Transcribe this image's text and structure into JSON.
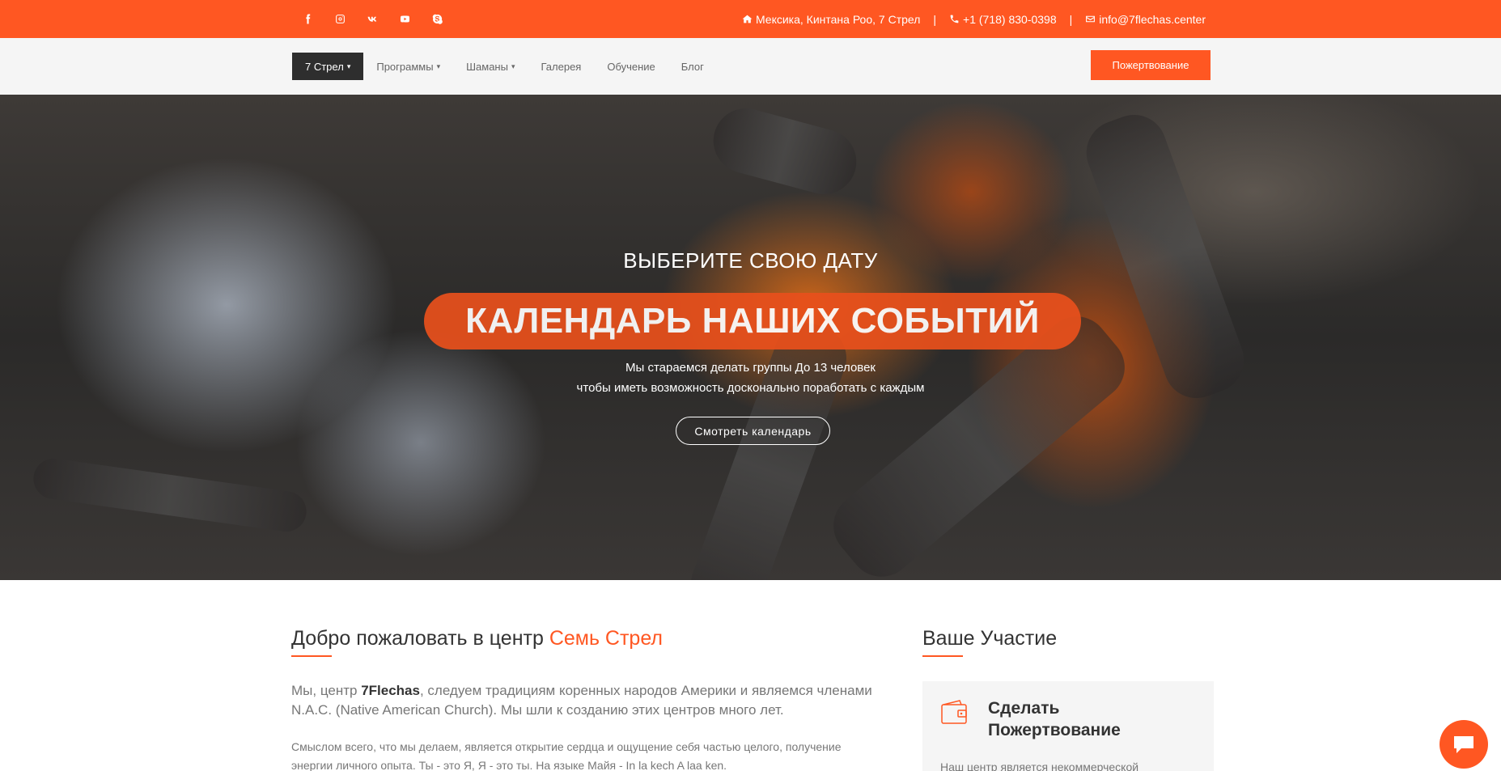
{
  "topbar": {
    "social": [
      {
        "icon": "facebook-icon",
        "glyph": "f"
      },
      {
        "icon": "instagram-icon",
        "glyph": "◎"
      },
      {
        "icon": "vk-icon",
        "glyph": "vk"
      },
      {
        "icon": "youtube-icon",
        "glyph": "▶"
      },
      {
        "icon": "skype-icon",
        "glyph": "S"
      }
    ],
    "address": "Мексика, Кинтана Роо, 7 Стрел",
    "separator": "|",
    "phone": "+1 (718) 830-0398",
    "email": "info@7flechas.center"
  },
  "nav": {
    "items": [
      {
        "label": "7 Стрел",
        "dropdown": true,
        "active": true
      },
      {
        "label": "Программы",
        "dropdown": true,
        "active": false
      },
      {
        "label": "Шаманы",
        "dropdown": true,
        "active": false
      },
      {
        "label": "Галерея",
        "dropdown": false,
        "active": false
      },
      {
        "label": "Обучение",
        "dropdown": false,
        "active": false
      },
      {
        "label": "Блог",
        "dropdown": false,
        "active": false
      }
    ],
    "donate_label": "Пожертвование"
  },
  "hero": {
    "subtitle": "ВЫБЕРИТЕ СВОЮ ДАТУ",
    "title": "КАЛЕНДАРЬ НАШИХ СОБЫТИЙ",
    "line1": "Мы стараемся делать группы До 13 человек",
    "line2": "чтобы иметь возможность досконально поработать с каждым",
    "button_label": "Смотреть календарь"
  },
  "welcome": {
    "title_prefix": "Добро пожаловать в центр ",
    "title_accent": "Семь Стрел",
    "intro_prefix": "Мы, центр ",
    "intro_bold": "7Flechas",
    "intro_suffix": ", следуем традициям коренных народов Америки и являемся членами N.A.C. (Native American Church). Мы шли к созданию этих центров много лет.",
    "body_line1": "Смыслом всего, что мы делаем, является открытие сердца и ощущение себя частью целого, получение",
    "body_line2": "энергии личного опыта. Ты - это Я, Я - это ты. На языке Майя - In la kech A laa ken."
  },
  "participation": {
    "title": "Ваше Участие",
    "card_title_line1": "Сделать",
    "card_title_line2": "Пожертвование",
    "card_text": "Наш центр является некоммерческой"
  },
  "colors": {
    "accent": "#ff5722",
    "nav_bg": "#f5f5f5",
    "active_nav": "#2e2e2e"
  }
}
